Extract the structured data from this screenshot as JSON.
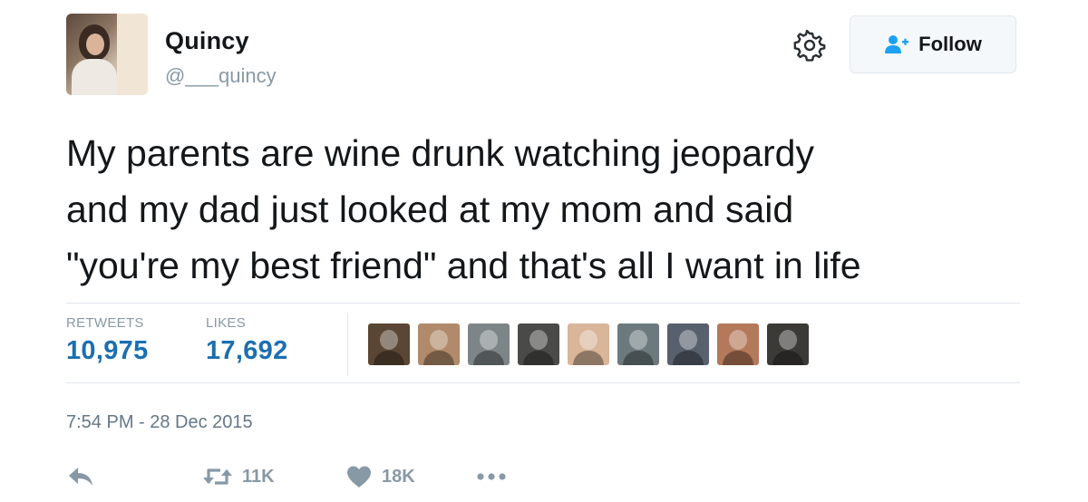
{
  "tweet": {
    "user": {
      "name": "Quincy",
      "handle": "@___quincy"
    },
    "follow_label": "Follow",
    "text_lines": [
      "My parents are wine drunk watching jeopardy",
      "and my dad just looked at my mom and said",
      "\"you're my best friend\" and that's all I want in life"
    ],
    "stats": {
      "retweets_label": "RETWEETS",
      "retweets_value": "10,975",
      "likes_label": "LIKES",
      "likes_value": "17,692"
    },
    "likers": [
      {
        "color": "#5a4634"
      },
      {
        "color": "#b08a6a"
      },
      {
        "color": "#7d8588"
      },
      {
        "color": "#4a4a48"
      },
      {
        "color": "#d9b59a"
      },
      {
        "color": "#6c7a7e"
      },
      {
        "color": "#58606d"
      },
      {
        "color": "#b4795a"
      },
      {
        "color": "#3b3a36"
      }
    ],
    "timestamp": "7:54 PM - 28 Dec 2015",
    "actions": {
      "reply_icon": "reply-icon",
      "retweet_count": "11K",
      "like_count": "18K",
      "more_icon": "more-icon"
    },
    "colors": {
      "accent": "#1b6fb0",
      "muted": "#8899a6",
      "follow_icon": "#1da1f2"
    }
  }
}
